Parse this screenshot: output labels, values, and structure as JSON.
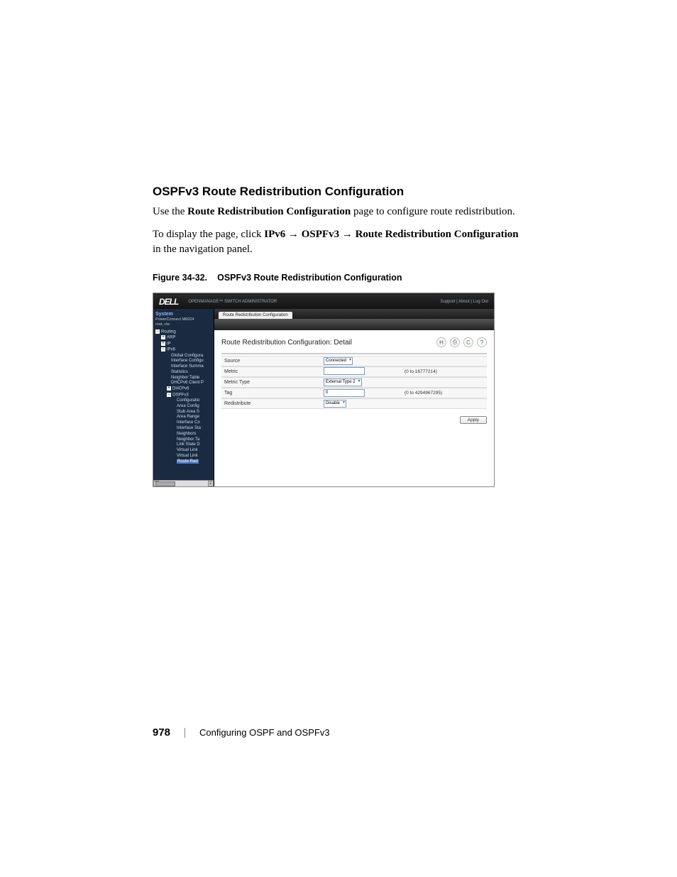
{
  "heading": "OSPFv3 Route Redistribution Configuration",
  "para1_a": "Use the ",
  "para1_b": "Route Redistribution Configuration",
  "para1_c": " page to configure route redistribution.",
  "para2_a": "To display the page, click ",
  "para2_b": "IPv6",
  "para2_c": "OSPFv3",
  "para2_d": "Route Redistribution Configuration",
  "para2_e": " in the navigation panel.",
  "arrow": "→",
  "figure_num": "Figure 34-32.",
  "figure_title": "OSPFv3 Route Redistribution Configuration",
  "ss": {
    "logo": "DELL",
    "suite": "OPENMANAGE™ SWITCH ADMINISTRATOR",
    "top_links": "Support | About | Log Out",
    "system": "System",
    "device": "PowerConnect M6024",
    "user": "root, r/w",
    "tree": {
      "routing": "Routing",
      "arp": "ARP",
      "ip": "IP",
      "ipv6": "IPv6",
      "gc": "Global Configura",
      "ic": "Interface Configu",
      "is": "Interface Summa",
      "stats": "Statistics",
      "nt": "Neighbor Table",
      "dcp": "DHCPv6 Client P",
      "dhcpv6": "DHCPv6",
      "ospfv3": "OSPFv3",
      "conf": "Configuratio",
      "areaconf": "Area Config",
      "stub": "Stub Area S",
      "range": "Area Range",
      "ifc": "Interface Co",
      "ifs": "Interface Sta",
      "neigh": "Neighbors",
      "neight": "Neighbor Ta",
      "lsd": "Link State D",
      "vlink": "Virtual Link",
      "vlinks": "Virtual Link",
      "rr": "Route Red"
    },
    "tab": "Route Redistribution Configuration",
    "panel_title": "Route Redistribution Configuration: Detail",
    "icons": {
      "save": "H",
      "print": "⎙",
      "refresh": "C",
      "help": "?"
    },
    "form": {
      "source_label": "Source",
      "source_value": "Connected",
      "metric_label": "Metric",
      "metric_value": "",
      "metric_hint": "(0 to 16777214)",
      "mtype_label": "Metric Type",
      "mtype_value": "External Type 2",
      "tag_label": "Tag",
      "tag_value": "0",
      "tag_hint": "(0 to 4294967295)",
      "redist_label": "Redistribute",
      "redist_value": "Disable"
    },
    "apply": "Apply"
  },
  "footer": {
    "page": "978",
    "chapter": "Configuring OSPF and OSPFv3"
  }
}
